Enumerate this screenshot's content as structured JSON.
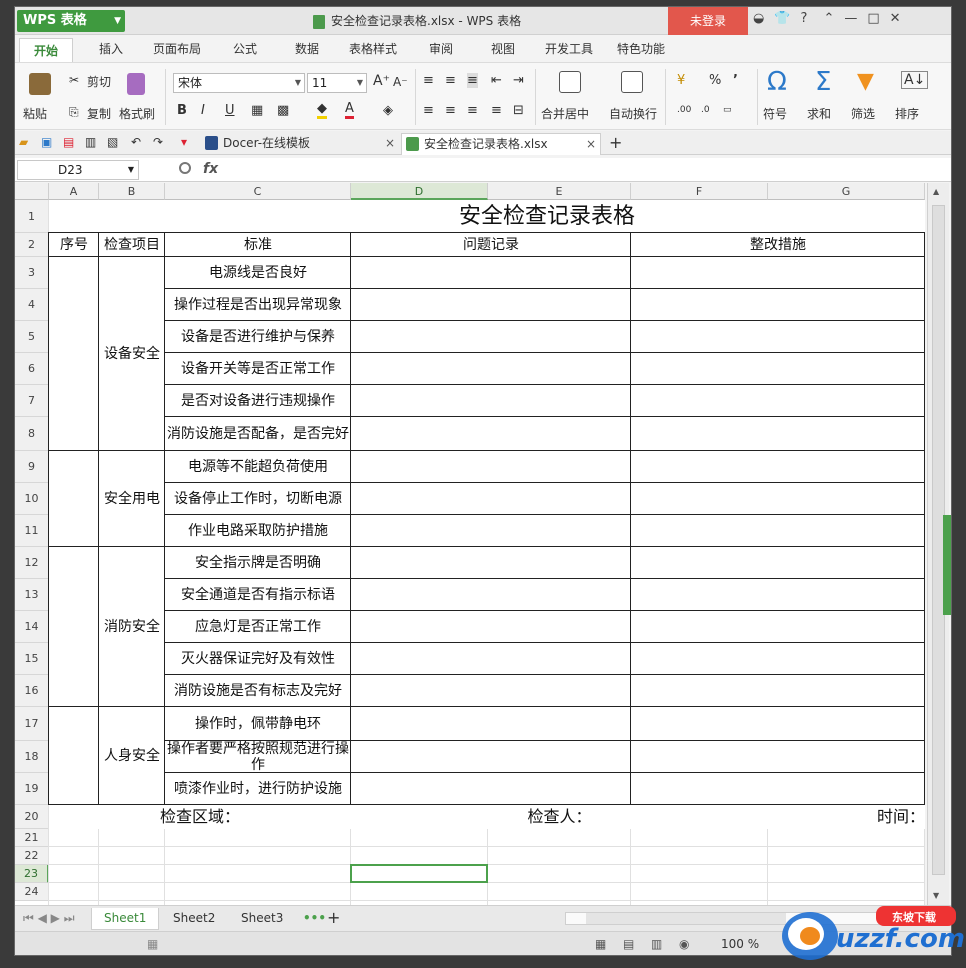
{
  "app": {
    "name": "WPS 表格",
    "title": "安全检查记录表格.xlsx - WPS 表格",
    "login": "未登录",
    "accent": "#3f9a3f"
  },
  "menu": {
    "tabs": [
      "开始",
      "插入",
      "页面布局",
      "公式",
      "数据",
      "表格样式",
      "审阅",
      "视图",
      "开发工具",
      "特色功能"
    ]
  },
  "ribbon": {
    "paste": "粘贴",
    "cut": "剪切",
    "copy": "复制",
    "format_painter": "格式刷",
    "font_name": "宋体",
    "font_size": "11",
    "merge_center": "合并居中",
    "wrap_text": "自动换行",
    "symbol": "符号",
    "sum": "求和",
    "filter": "筛选",
    "sort": "排序",
    "percent": "%",
    "comma": "’",
    "bold": "B",
    "italic": "I",
    "underline": "U"
  },
  "doc_tabs": {
    "tab1": "Docer-在线模板",
    "tab2": "安全检查记录表格.xlsx",
    "new_tab": "+"
  },
  "formula_bar": {
    "cell_ref": "D23",
    "fx": "fx",
    "value": ""
  },
  "columns": [
    "A",
    "B",
    "C",
    "D",
    "E",
    "F",
    "G"
  ],
  "rows": [
    "1",
    "2",
    "3",
    "4",
    "5",
    "6",
    "7",
    "8",
    "9",
    "10",
    "11",
    "12",
    "13",
    "14",
    "15",
    "16",
    "17",
    "18",
    "19",
    "20",
    "21",
    "22",
    "23",
    "24"
  ],
  "sheet": {
    "title": "安全检查记录表格",
    "headers": {
      "seq": "序号",
      "item": "检查项目",
      "standard": "标准",
      "issue": "问题记录",
      "fix": "整改措施"
    },
    "groups": [
      {
        "name": "设备安全",
        "standards": [
          "电源线是否良好",
          "操作过程是否出现异常现象",
          "设备是否进行维护与保养",
          "设备开关等是否正常工作",
          "是否对设备进行违规操作",
          "消防设施是否配备，是否完好"
        ]
      },
      {
        "name": "安全用电",
        "standards": [
          "电源等不能超负荷使用",
          "设备停止工作时，切断电源",
          "作业电路采取防护措施"
        ]
      },
      {
        "name": "消防安全",
        "standards": [
          "安全指示牌是否明确",
          "安全通道是否有指示标语",
          "应急灯是否正常工作",
          "灭火器保证完好及有效性",
          "消防设施是否有标志及完好"
        ]
      },
      {
        "name": "人身安全",
        "standards": [
          "操作时，佩带静电环",
          "操作者要严格按照规范进行操作",
          "喷漆作业时，进行防护设施"
        ]
      }
    ],
    "footer": {
      "area": "检查区域：",
      "inspector": "检查人：",
      "time": "时间："
    }
  },
  "sheet_tabs": [
    "Sheet1",
    "Sheet2",
    "Sheet3"
  ],
  "sheet_more": "•••",
  "status": {
    "zoom": "100 %"
  },
  "watermark": {
    "text": "uzzf.com",
    "sub": "东坡下载"
  }
}
